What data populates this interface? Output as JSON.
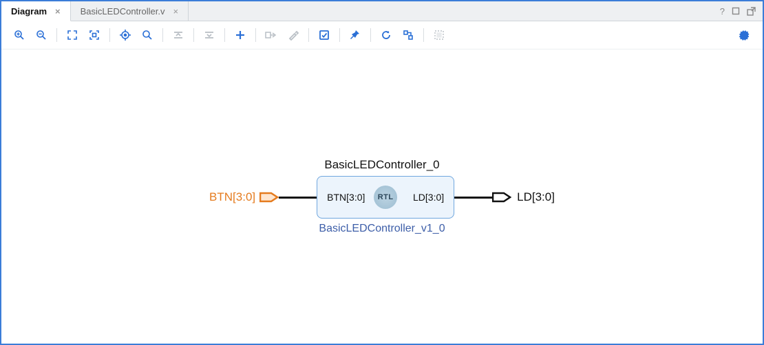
{
  "tabs": [
    {
      "label": "Diagram",
      "active": true
    },
    {
      "label": "BasicLEDController.v",
      "active": false
    }
  ],
  "titlebar_icons": {
    "help": "?",
    "maximize": "◻",
    "popout": "⇱"
  },
  "toolbar": {
    "zoom_in": {
      "tip": "Zoom In"
    },
    "zoom_out": {
      "tip": "Zoom Out"
    },
    "zoom_fit": {
      "tip": "Zoom Fit"
    },
    "zoom_area": {
      "tip": "Zoom to Area"
    },
    "center": {
      "tip": "Center Selection"
    },
    "search": {
      "tip": "Search"
    },
    "collapse": {
      "tip": "Collapse"
    },
    "expand": {
      "tip": "Expand"
    },
    "add_ip": {
      "tip": "Add IP"
    },
    "make_ext": {
      "tip": "Make External"
    },
    "customize": {
      "tip": "Customize Block"
    },
    "validate": {
      "tip": "Validate Design"
    },
    "pin": {
      "tip": "Pin"
    },
    "regen": {
      "tip": "Regenerate Layout"
    },
    "optimize": {
      "tip": "Optimize Routing"
    },
    "fit_area": {
      "tip": "Fit Area"
    },
    "settings": {
      "tip": "Settings"
    }
  },
  "diagram": {
    "instance_name": "BasicLEDController_0",
    "ip_name": "BasicLEDController_v1_0",
    "badge": "RTL",
    "input_port": {
      "external_label": "BTN[3:0]",
      "pin_label": "BTN[3:0]"
    },
    "output_port": {
      "external_label": "LD[3:0]",
      "pin_label": "LD[3:0]"
    }
  }
}
